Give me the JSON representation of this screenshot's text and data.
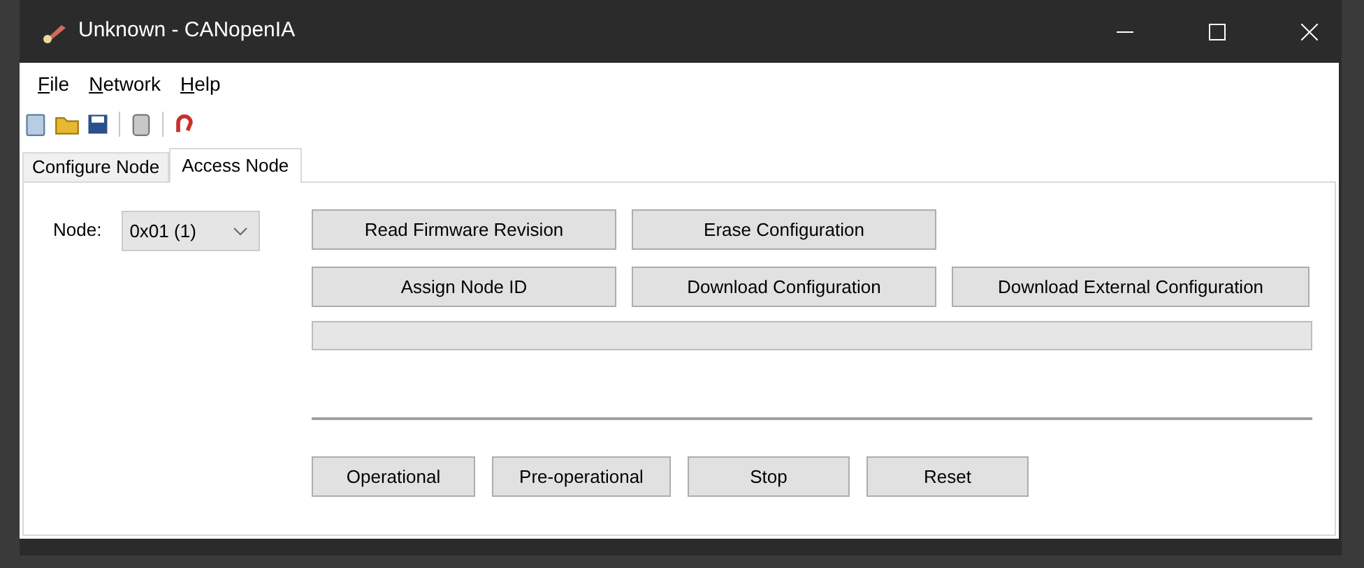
{
  "window": {
    "title": "Unknown - CANopenIA"
  },
  "menu": [
    {
      "label": "File"
    },
    {
      "label": "Network"
    },
    {
      "label": "Help"
    }
  ],
  "toolbar": [
    {
      "kind": "new"
    },
    {
      "kind": "open"
    },
    {
      "kind": "save"
    },
    {
      "kind": "separator"
    },
    {
      "kind": "device"
    },
    {
      "kind": "separator"
    },
    {
      "kind": "magnet"
    }
  ],
  "tabs": [
    {
      "label": "Configure Node",
      "selected": false
    },
    {
      "label": "Access Node",
      "selected": true
    }
  ],
  "node": {
    "label": "Node:",
    "value": "0x01 (1)"
  },
  "action_rows": [
    [
      "Read Firmware Revision",
      "Erase Configuration"
    ],
    [
      "Assign Node ID",
      "Download Configuration",
      "Download External Configuration"
    ]
  ],
  "progress_bar": {
    "level": 0
  },
  "state_buttons": [
    "Operational",
    "Pre-operational",
    "Stop",
    "Reset"
  ]
}
